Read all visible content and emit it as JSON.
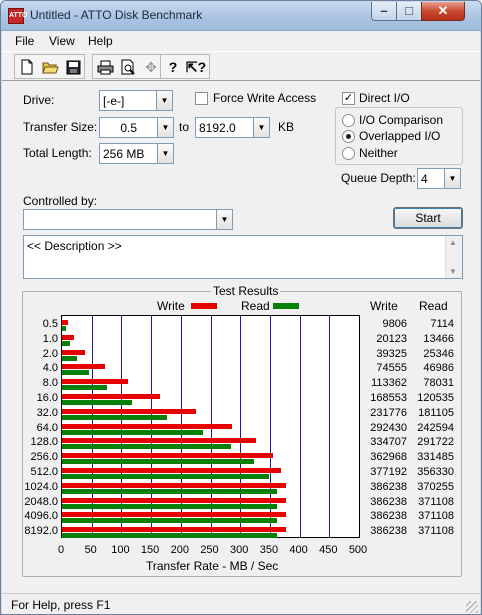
{
  "window": {
    "title": "Untitled - ATTO Disk Benchmark",
    "app_icon_text": "ATTO"
  },
  "menu": [
    "File",
    "View",
    "Help"
  ],
  "toolbar_icons": [
    "new-icon",
    "open-icon",
    "save-icon",
    "print-icon",
    "print-preview-icon",
    "move-icon",
    "help-icon",
    "context-help-icon"
  ],
  "settings": {
    "drive_label": "Drive:",
    "drive_value": "[-e-]",
    "force_write_access_label": "Force Write Access",
    "force_write_access_checked": false,
    "direct_io_label": "Direct I/O",
    "direct_io_checked": true,
    "transfer_size_label": "Transfer Size:",
    "transfer_from": "0.5",
    "to_label": "to",
    "transfer_to": "8192.0",
    "kb_label": "KB",
    "total_length_label": "Total Length:",
    "total_length_value": "256 MB",
    "io_options": [
      "I/O Comparison",
      "Overlapped I/O",
      "Neither"
    ],
    "io_selected": "Overlapped I/O",
    "queue_depth_label": "Queue Depth:",
    "queue_depth_value": "4",
    "controlled_by_label": "Controlled by:",
    "controlled_by_value": "",
    "start_label": "Start",
    "description_text": "<< Description >>"
  },
  "results": {
    "title": "Test Results",
    "legend_write": "Write",
    "legend_read": "Read",
    "col_write": "Write",
    "col_read": "Read",
    "x_axis_label": "Transfer Rate - MB / Sec"
  },
  "chart_data": {
    "type": "bar",
    "orientation": "horizontal",
    "title": "Test Results",
    "xlabel": "Transfer Rate - MB / Sec",
    "ylabel": "",
    "xlim": [
      0,
      500
    ],
    "xticks": [
      0,
      50,
      100,
      150,
      200,
      250,
      300,
      350,
      400,
      450,
      500
    ],
    "categories": [
      "0.5",
      "1.0",
      "2.0",
      "4.0",
      "8.0",
      "16.0",
      "32.0",
      "64.0",
      "128.0",
      "256.0",
      "512.0",
      "1024.0",
      "2048.0",
      "4096.0",
      "8192.0"
    ],
    "series": [
      {
        "name": "Write",
        "color": "#e60000",
        "values": [
          9806,
          20123,
          39325,
          74555,
          113362,
          168553,
          231776,
          292430,
          334707,
          362968,
          377192,
          386238,
          386238,
          386238,
          386238
        ]
      },
      {
        "name": "Read",
        "color": "#068006",
        "values": [
          7114,
          13466,
          25346,
          46986,
          78031,
          120535,
          181105,
          242594,
          291722,
          331485,
          356330,
          370255,
          371108,
          371108,
          371108
        ]
      }
    ],
    "units": "KB/s"
  },
  "status": {
    "text": "For Help, press F1"
  }
}
